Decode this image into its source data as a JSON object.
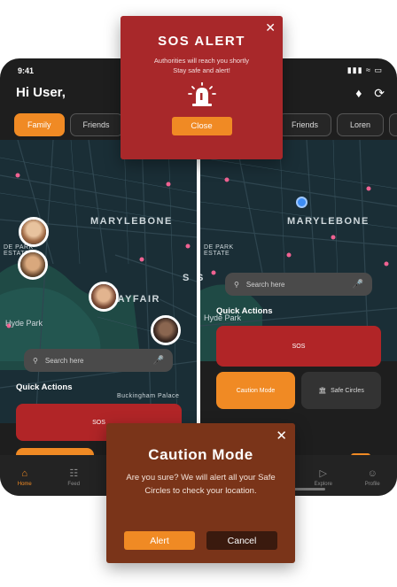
{
  "status": {
    "time": "9:41"
  },
  "header": {
    "greeting": "Hi User,"
  },
  "chips_left": [
    "Family",
    "Friends",
    ""
  ],
  "chips_right": [
    "",
    "Friends",
    "Loren",
    ""
  ],
  "map": {
    "labels": {
      "marylebone": "MARYLEBONE",
      "mayfair": "MAYFAIR",
      "hyde_park": "Hyde Park",
      "hyde_park_estate": "DE PARK\nESTATE",
      "hyde_park_estate_r": "DE PARK\nESTATE",
      "buckingham": "Buckingham Palace",
      "s": "S",
      "s_r": "S"
    }
  },
  "search": {
    "placeholder": "Search here"
  },
  "quick_actions": {
    "title": "Quick Actions",
    "sos": "SOS",
    "caution": "Caution Mode",
    "safe_circles": "Safe Circles"
  },
  "tabs_left": [
    {
      "label": "Home",
      "icon": "home-icon"
    },
    {
      "label": "Feed",
      "icon": "feed-icon"
    }
  ],
  "tabs_right": [
    {
      "label": "Explore",
      "icon": "explore-icon"
    },
    {
      "label": "Profile",
      "icon": "profile-icon"
    }
  ],
  "sos_modal": {
    "title": "SOS ALERT",
    "line1": "Authorities will reach you shortly",
    "line2": "Stay safe and alert!",
    "close": "Close"
  },
  "caution_modal": {
    "title": "Caution Mode",
    "message": "Are you sure? We will alert all your Safe Circles to check your location.",
    "alert": "Alert",
    "cancel": "Cancel"
  },
  "colors": {
    "accent": "#f08a24",
    "sos_red": "#b12527",
    "caution_brown": "#7a3419",
    "background_dark": "#1e1e1e"
  }
}
